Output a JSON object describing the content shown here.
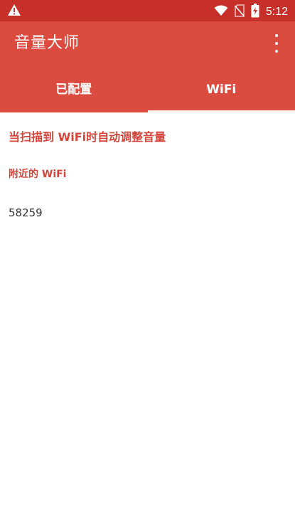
{
  "status_bar": {
    "time": "5:12",
    "icons": [
      "warning-icon",
      "wifi-icon",
      "no-sim-icon",
      "battery-charging-icon"
    ]
  },
  "app_bar": {
    "title": "音量大师",
    "menu_icon": "more-vert-icon"
  },
  "tabs": [
    {
      "label": "已配置",
      "active": false
    },
    {
      "label": "WiFi",
      "active": true
    }
  ],
  "content": {
    "headline": "当扫描到 WiFi时自动调整音量",
    "subhead": "附近的 WiFi",
    "wifi_list": [
      "58259"
    ]
  },
  "colors": {
    "status_bar": "#c62f2a",
    "primary": "#dc4b40",
    "accent_text": "#d3463c"
  }
}
